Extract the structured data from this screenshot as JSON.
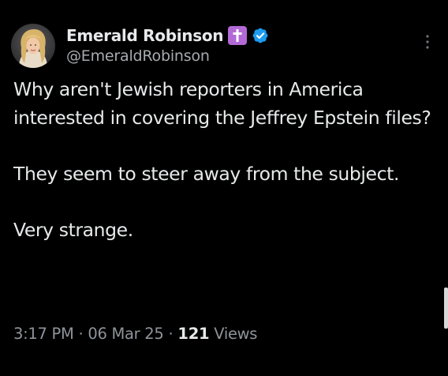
{
  "post": {
    "author": {
      "display_name": "Emerald Robinson",
      "handle": "@EmeraldRobinson",
      "badge_icon": "cross-icon",
      "verified_icon": "verified-badge-icon"
    },
    "paragraphs": [
      "Why aren't Jewish reporters in America interested in covering the Jeffrey Epstein files?",
      "They seem to steer away from the subject.",
      "Very strange."
    ],
    "meta": {
      "time": "3:17 PM",
      "separator": "·",
      "date": "06 Mar 25",
      "views_count": "121",
      "views_label": "Views"
    }
  },
  "colors": {
    "background": "#000000",
    "text": "#e7e9ea",
    "muted": "#8e949a",
    "verified_blue": "#1d9bf0",
    "cross_badge_purple": "#b36ad6"
  }
}
